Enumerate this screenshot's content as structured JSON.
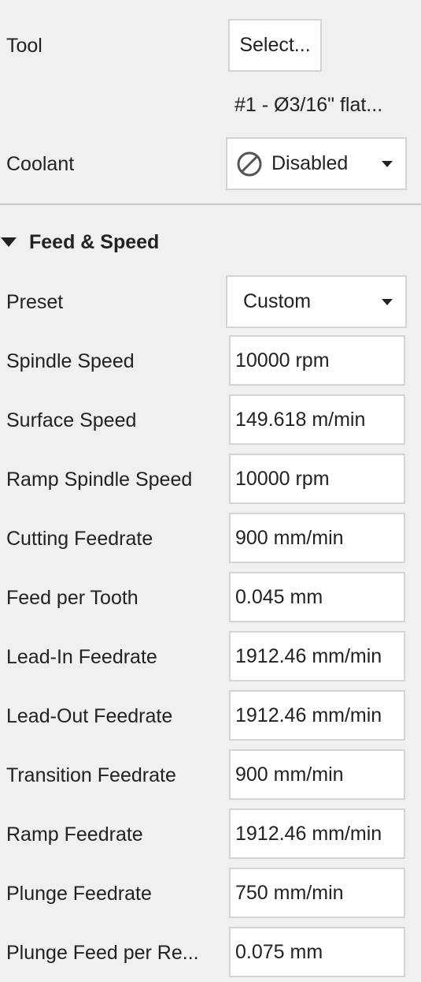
{
  "tool": {
    "label": "Tool",
    "select_button": "Select...",
    "description": "#1 - Ø3/16\" flat..."
  },
  "coolant": {
    "label": "Coolant",
    "value": "Disabled",
    "icon": "ban-icon"
  },
  "feed_speed": {
    "section_title": "Feed & Speed",
    "preset": {
      "label": "Preset",
      "value": "Custom"
    },
    "fields": [
      {
        "label": "Spindle Speed",
        "value": "10000 rpm"
      },
      {
        "label": "Surface Speed",
        "value": "149.618 m/min"
      },
      {
        "label": "Ramp Spindle Speed",
        "value": "10000 rpm"
      },
      {
        "label": "Cutting Feedrate",
        "value": "900 mm/min"
      },
      {
        "label": "Feed per Tooth",
        "value": "0.045 mm"
      },
      {
        "label": "Lead-In Feedrate",
        "value": "1912.46 mm/min"
      },
      {
        "label": "Lead-Out Feedrate",
        "value": "1912.46 mm/min"
      },
      {
        "label": "Transition Feedrate",
        "value": "900 mm/min"
      },
      {
        "label": "Ramp Feedrate",
        "value": "1912.46 mm/min"
      },
      {
        "label": "Plunge Feedrate",
        "value": "750 mm/min"
      },
      {
        "label": "Plunge Feed per Re...",
        "value": "0.075 mm"
      }
    ]
  }
}
